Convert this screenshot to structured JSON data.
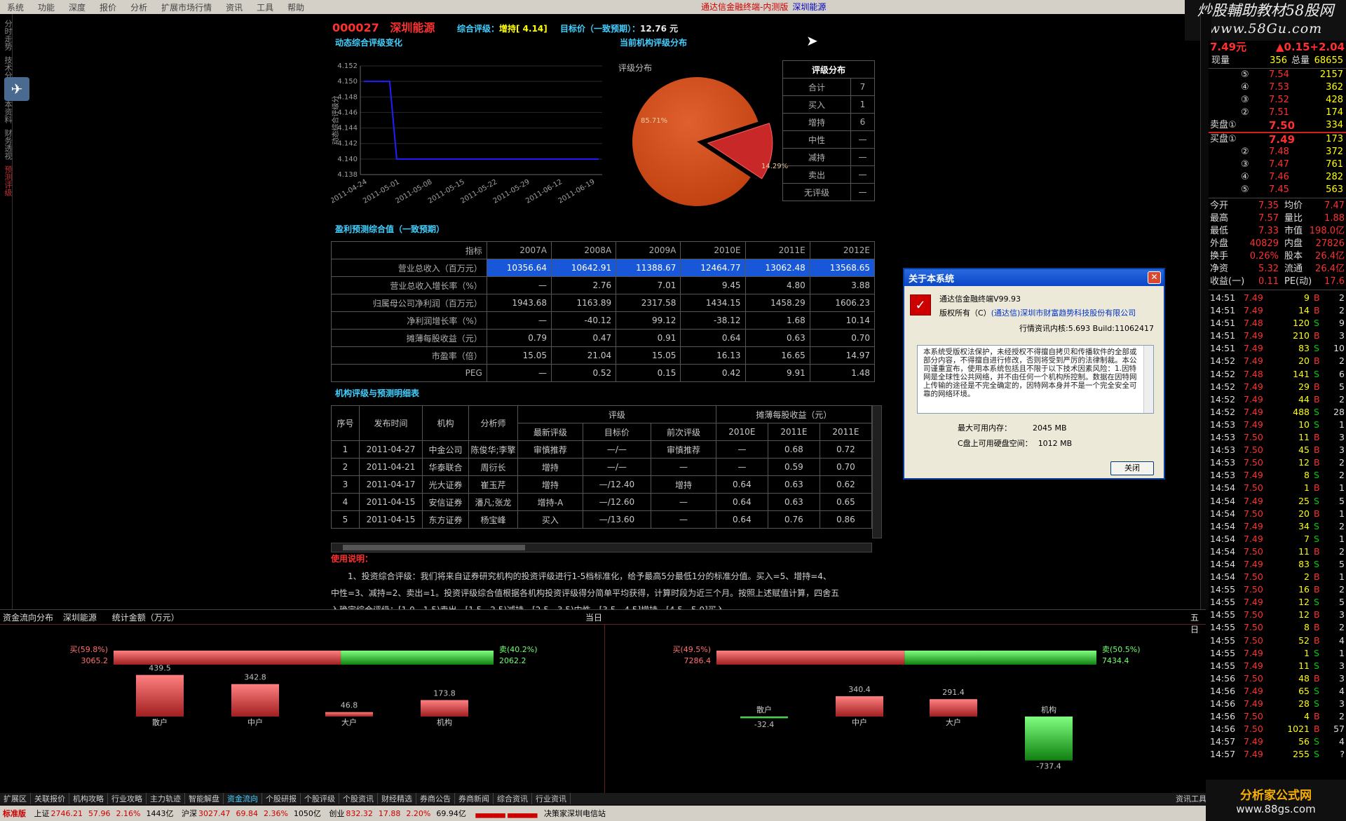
{
  "menu": [
    "系统",
    "功能",
    "深度",
    "报价",
    "分析",
    "扩展市场行情",
    "资讯",
    "工具",
    "帮助"
  ],
  "window_title": "通达信金融终端-内测版",
  "window_title_stock": "深圳能源",
  "logo_top": {
    "line1": "炒股輔助教材58股网",
    "line2": "www.58Gu.com"
  },
  "left_tabs": [
    "分时走势",
    "技术分析",
    "基本资料",
    "财务透视",
    "预测评级"
  ],
  "stock": {
    "code": "000027",
    "name": "深圳能源",
    "rating_label": "综合评级：",
    "rating_value": "增持[ 4.14]",
    "target_label": "目标价（一致预期）：",
    "target_value": "12.76 元"
  },
  "section_titles": {
    "dynamic": "动态综合评级变化",
    "current_dist": "当前机构评级分布",
    "profit_pred": "盈利预测综合值（一致预期）",
    "inst_detail": "机构评级与预测明细表",
    "usage": "使用说明："
  },
  "line_chart": {
    "ylabel": "动态综合评级分",
    "yticks": [
      "4.152",
      "4.150",
      "4.148",
      "4.146",
      "4.144",
      "4.142",
      "4.140",
      "4.138"
    ],
    "xticks": [
      "2011-04-24",
      "2011-05-01",
      "2011-05-08",
      "2011-05-15",
      "2011-05-22",
      "2011-05-29",
      "2011-06-12",
      "2011-06-19"
    ]
  },
  "pie_title": "评级分布",
  "pie_labels": {
    "big": "85.71%",
    "small": "14.29%"
  },
  "dist_table": {
    "header": "评级分布",
    "rows": [
      [
        "合计",
        "7"
      ],
      [
        "买入",
        "1"
      ],
      [
        "增持",
        "6"
      ],
      [
        "中性",
        "—"
      ],
      [
        "减持",
        "—"
      ],
      [
        "卖出",
        "—"
      ],
      [
        "无评级",
        "—"
      ]
    ]
  },
  "pred_table": {
    "headers": [
      "指标",
      "2007A",
      "2008A",
      "2009A",
      "2010E",
      "2011E",
      "2012E"
    ],
    "rows": [
      [
        "营业总收入（百万元）",
        "10356.64",
        "10642.91",
        "11388.67",
        "12464.77",
        "13062.48",
        "13568.65"
      ],
      [
        "营业总收入增长率（%）",
        "—",
        "2.76",
        "7.01",
        "9.45",
        "4.80",
        "3.88"
      ],
      [
        "归属母公司净利润（百万元）",
        "1943.68",
        "1163.89",
        "2317.58",
        "1434.15",
        "1458.29",
        "1606.23"
      ],
      [
        "净利润增长率（%）",
        "—",
        "-40.12",
        "99.12",
        "-38.12",
        "1.68",
        "10.14"
      ],
      [
        "摊薄每股收益（元）",
        "0.79",
        "0.47",
        "0.91",
        "0.64",
        "0.63",
        "0.70"
      ],
      [
        "市盈率（倍）",
        "15.05",
        "21.04",
        "15.05",
        "16.13",
        "16.65",
        "14.97"
      ],
      [
        "PEG",
        "—",
        "0.52",
        "0.15",
        "0.42",
        "9.91",
        "1.48"
      ]
    ]
  },
  "rate_table": {
    "h1": [
      "序号",
      "发布时间",
      "机构",
      "分析师",
      "评级",
      "摊薄每股收益（元）"
    ],
    "h2": [
      "最新评级",
      "目标价",
      "前次评级",
      "2010E",
      "2011E",
      "2011E"
    ],
    "rows": [
      [
        "1",
        "2011-04-27",
        "中金公司",
        "陈俊华;李擎",
        "审慎推荐",
        "—/—",
        "审慎推荐",
        "—",
        "0.68",
        "0.72"
      ],
      [
        "2",
        "2011-04-21",
        "华泰联合",
        "周衍长",
        "增持",
        "—/—",
        "—",
        "—",
        "0.59",
        "0.70"
      ],
      [
        "3",
        "2011-04-17",
        "光大证券",
        "崔玉芹",
        "增持",
        "—/12.40",
        "增持",
        "0.64",
        "0.63",
        "0.62"
      ],
      [
        "4",
        "2011-04-15",
        "安信证券",
        "潘凡;张龙",
        "增持-A",
        "—/12.60",
        "—",
        "0.64",
        "0.63",
        "0.65"
      ],
      [
        "5",
        "2011-04-15",
        "东方证券",
        "杨宝峰",
        "买入",
        "—/13.60",
        "—",
        "0.64",
        "0.76",
        "0.86"
      ]
    ]
  },
  "usage_text": [
    "1、投资综合评级：我们将来自证券研究机构的投资评级进行1-5档标准化，给予最高5分最低1分的标准分值。买入=5、增持=4、",
    "中性=3、减持=2、卖出=1。投资评级综合值根据各机构投资评级得分简单平均获得，计算时段为近三个月。按照上述赋值计算，四舍五",
    "入确定综合评级：[1.0，1.5)卖出、[1.5，2.5)减持、[2.5，3.5)中性、[3.5，4.5]增持、[4.5，5.0]买入。"
  ],
  "dialog": {
    "title": "关于本系统",
    "product": "通达信金融终端V99.93",
    "copyright_label": "版权所有（C）",
    "copyright_link": "(通达信)深圳市财富趋势科技股份有限公司",
    "kernel": "行情资讯内核:5.693 Build:11062417",
    "notice": "本系统受版权法保护，未经授权不得擅自拷贝和传播软件的全部或部分内容，不得擅自进行修改，否则将受到严厉的法律制裁。本公司谨重宣布，使用本系统包括且不限于以下技术因素风险：1.因特网是全球性公共网络，并不由任何一个机构所控制。数据在因特网上传输的途径是不完全确定的，因特网本身并不是一个完全安全可靠的网络环境。",
    "mem_label": "最大可用内存：",
    "mem_value": "2045 MB",
    "disk_label": "C盘上可用硬盘空间：",
    "disk_value": "1012 MB",
    "close_label": "关闭"
  },
  "quote": {
    "price": "7.49元",
    "change": "▲0.15",
    "pct": "+2.04",
    "vol_row": [
      "现量",
      "356",
      "总量",
      "68655"
    ],
    "sells": [
      [
        "⑤",
        "7.54",
        "2157"
      ],
      [
        "④",
        "7.53",
        "362"
      ],
      [
        "③",
        "7.52",
        "428"
      ],
      [
        "②",
        "7.51",
        "174"
      ],
      [
        "卖盘①",
        "7.50",
        "334"
      ]
    ],
    "buys": [
      [
        "买盘①",
        "7.49",
        "173"
      ],
      [
        "②",
        "7.48",
        "372"
      ],
      [
        "③",
        "7.47",
        "761"
      ],
      [
        "④",
        "7.46",
        "282"
      ],
      [
        "⑤",
        "7.45",
        "563"
      ]
    ],
    "stats": [
      [
        "今开",
        "7.35",
        "均价",
        "7.47"
      ],
      [
        "最高",
        "7.57",
        "量比",
        "1.88"
      ],
      [
        "最低",
        "7.33",
        "市值",
        "198.0亿"
      ],
      [
        "外盘",
        "40829",
        "内盘",
        "27826"
      ],
      [
        "换手",
        "0.26%",
        "股本",
        "26.4亿"
      ],
      [
        "净资",
        "5.32",
        "流通",
        "26.4亿"
      ],
      [
        "收益(一)",
        "0.11",
        "PE(动)",
        "17.6"
      ]
    ],
    "ticks": [
      [
        "14:51",
        "7.49",
        "9",
        "B",
        "2"
      ],
      [
        "14:51",
        "7.49",
        "14",
        "B",
        "2"
      ],
      [
        "14:51",
        "7.48",
        "120",
        "S",
        "9"
      ],
      [
        "14:51",
        "7.49",
        "210",
        "B",
        "3"
      ],
      [
        "14:51",
        "7.49",
        "83",
        "S",
        "10"
      ],
      [
        "14:52",
        "7.49",
        "20",
        "B",
        "2"
      ],
      [
        "14:52",
        "7.48",
        "141",
        "S",
        "6"
      ],
      [
        "14:52",
        "7.49",
        "29",
        "B",
        "5"
      ],
      [
        "14:52",
        "7.49",
        "44",
        "B",
        "2"
      ],
      [
        "14:52",
        "7.49",
        "488",
        "S",
        "28"
      ],
      [
        "14:53",
        "7.49",
        "10",
        "S",
        "1"
      ],
      [
        "14:53",
        "7.50",
        "11",
        "B",
        "3"
      ],
      [
        "14:53",
        "7.50",
        "45",
        "B",
        "3"
      ],
      [
        "14:53",
        "7.50",
        "12",
        "B",
        "2"
      ],
      [
        "14:53",
        "7.49",
        "8",
        "S",
        "2"
      ],
      [
        "14:54",
        "7.50",
        "1",
        "B",
        "1"
      ],
      [
        "14:54",
        "7.49",
        "25",
        "S",
        "5"
      ],
      [
        "14:54",
        "7.50",
        "20",
        "B",
        "1"
      ],
      [
        "14:54",
        "7.49",
        "34",
        "S",
        "2"
      ],
      [
        "14:54",
        "7.49",
        "7",
        "S",
        "1"
      ],
      [
        "14:54",
        "7.50",
        "11",
        "B",
        "2"
      ],
      [
        "14:54",
        "7.49",
        "83",
        "S",
        "5"
      ],
      [
        "14:54",
        "7.50",
        "2",
        "B",
        "1"
      ],
      [
        "14:55",
        "7.50",
        "16",
        "B",
        "2"
      ],
      [
        "14:55",
        "7.49",
        "12",
        "S",
        "5"
      ],
      [
        "14:55",
        "7.50",
        "12",
        "B",
        "3"
      ],
      [
        "14:55",
        "7.50",
        "8",
        "B",
        "2"
      ],
      [
        "14:55",
        "7.50",
        "52",
        "B",
        "4"
      ],
      [
        "14:55",
        "7.49",
        "1",
        "S",
        "1"
      ],
      [
        "14:55",
        "7.49",
        "11",
        "S",
        "3"
      ],
      [
        "14:56",
        "7.50",
        "48",
        "B",
        "3"
      ],
      [
        "14:56",
        "7.49",
        "65",
        "S",
        "4"
      ],
      [
        "14:56",
        "7.49",
        "28",
        "S",
        "3"
      ],
      [
        "14:56",
        "7.50",
        "4",
        "B",
        "2"
      ],
      [
        "14:56",
        "7.50",
        "1021",
        "B",
        "57"
      ],
      [
        "14:57",
        "7.49",
        "56",
        "S",
        "4"
      ],
      [
        "14:57",
        "7.49",
        "255",
        "S",
        "?"
      ]
    ]
  },
  "fund_flow": {
    "tabs": [
      "资金流向分布",
      "深圳能源",
      "统计金额（万元）"
    ],
    "today_label": "当日",
    "five_label": "五日",
    "left": {
      "buy_label": "买(59.8%)",
      "buy_val": "3065.2",
      "sell_label": "卖(40.2%)",
      "sell_val": "2062.2",
      "buy_pct": 59.8,
      "bars": [
        {
          "name": "散户",
          "value": 439.5
        },
        {
          "name": "中户",
          "value": 342.8
        },
        {
          "name": "大户",
          "value": 46.8
        },
        {
          "name": "机构",
          "value": 173.8
        }
      ]
    },
    "right": {
      "buy_label": "买(49.5%)",
      "buy_val": "7286.4",
      "sell_label": "卖(50.5%)",
      "sell_val": "7434.4",
      "buy_pct": 49.5,
      "bars": [
        {
          "name": "散户",
          "value": -32.4
        },
        {
          "name": "中户",
          "value": 340.4
        },
        {
          "name": "大户",
          "value": 291.4
        },
        {
          "name": "机构",
          "value": -737.4
        }
      ]
    }
  },
  "bottom_tabs": [
    "扩展区",
    "关联报价",
    "机构攻略",
    "行业攻略",
    "主力轨迹",
    "智能解盘",
    "资金流向",
    "个股研报",
    "个股评级",
    "个股资讯",
    "财经精选",
    "券商公告",
    "券商新闻",
    "综合资讯",
    "行业资讯"
  ],
  "bottom_tab_right": "资讯工具",
  "status": {
    "edition": "标准版",
    "sh": [
      "上证",
      "2746.21",
      "57.96",
      "2.16%",
      "1443亿"
    ],
    "hs": [
      "沪深",
      "3027.47",
      "69.84",
      "2.36%",
      "1050亿"
    ],
    "cy": [
      "创业",
      "832.32",
      "17.88",
      "2.20%",
      "69.94亿"
    ],
    "site": "决策家深圳电信站"
  },
  "logo_bottom": {
    "line1": "分析家公式网",
    "line2": "www.88gs.com"
  },
  "chart_data": [
    {
      "type": "line",
      "title": "动态综合评级变化",
      "ylabel": "动态综合评级分",
      "ylim": [
        4.138,
        4.152
      ],
      "x": [
        "2011-04-24",
        "2011-04-27",
        "2011-05-01",
        "2011-05-08",
        "2011-05-15",
        "2011-05-22",
        "2011-05-29",
        "2011-06-12",
        "2011-06-19",
        "2011-06-24"
      ],
      "values": [
        4.15,
        4.15,
        4.14,
        4.14,
        4.14,
        4.14,
        4.14,
        4.14,
        4.14,
        4.14
      ]
    },
    {
      "type": "pie",
      "title": "评级分布",
      "categories": [
        "增持",
        "买入"
      ],
      "values": [
        85.71,
        14.29
      ]
    },
    {
      "type": "bar",
      "title": "资金流向分布 当日",
      "categories": [
        "散户",
        "中户",
        "大户",
        "机构"
      ],
      "values": [
        439.5,
        342.8,
        46.8,
        173.8
      ]
    },
    {
      "type": "bar",
      "title": "资金流向分布 五日",
      "categories": [
        "散户",
        "中户",
        "大户",
        "机构"
      ],
      "values": [
        -32.4,
        340.4,
        291.4,
        -737.4
      ]
    }
  ]
}
